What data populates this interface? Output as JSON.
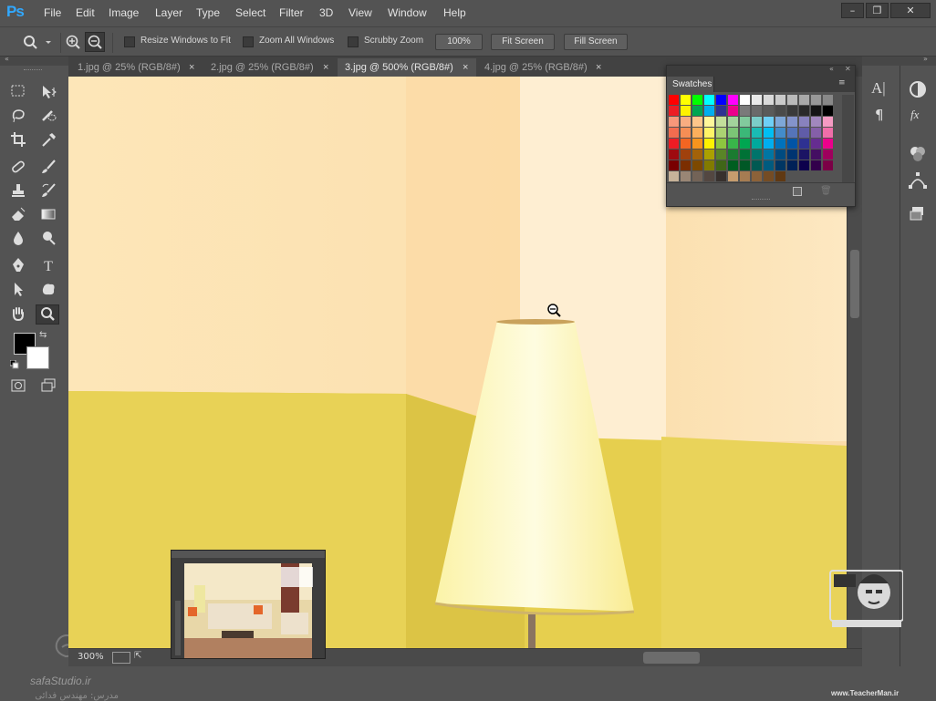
{
  "app": {
    "logo": "Ps"
  },
  "menu": [
    "File",
    "Edit",
    "Image",
    "Layer",
    "Type",
    "Select",
    "Filter",
    "3D",
    "View",
    "Window",
    "Help"
  ],
  "window_controls": {
    "minimize": "–",
    "restore": "❐",
    "close": "✕"
  },
  "options": {
    "resize_windows_label": "Resize Windows to Fit",
    "zoom_all_label": "Zoom All Windows",
    "scrubby_label": "Scrubby Zoom",
    "zoom_value": "100%",
    "fit_screen_label": "Fit Screen",
    "fill_screen_label": "Fill Screen"
  },
  "tabs": [
    {
      "label": "1.jpg @ 25% (RGB/8#)",
      "close": "×"
    },
    {
      "label": "2.jpg @ 25% (RGB/8#)",
      "close": "×"
    },
    {
      "label": "3.jpg @ 500% (RGB/8#)",
      "close": "×"
    },
    {
      "label": "4.jpg @ 25% (RGB/8#)",
      "close": "×"
    }
  ],
  "active_tab_index": 2,
  "swatches_panel": {
    "title": "Swatches"
  },
  "swatch_rows": [
    [
      "#ff0000",
      "#ffff00",
      "#00ff00",
      "#00ffff",
      "#0000ff",
      "#ff00ff",
      "#ffffff",
      "#e9e9e9",
      "#d9d9d9",
      "#cacaca",
      "#bababa",
      "#a9a9a9",
      "#989898",
      "#888888"
    ],
    [
      "#ed1c24",
      "#fff200",
      "#00a651",
      "#00aeef",
      "#2e3192",
      "#ec008c",
      "#7a7a7a",
      "#6a6a6a",
      "#5a5a5a",
      "#4a4a4a",
      "#3a3a3a",
      "#2a2a2a",
      "#151515",
      "#000000"
    ],
    [
      "#f7977a",
      "#f9ad81",
      "#fdc68a",
      "#fff79a",
      "#c4df9b",
      "#a3d39c",
      "#82ca9d",
      "#7bcdc8",
      "#6ecff6",
      "#7ea7d8",
      "#8493ca",
      "#8882be",
      "#a187be",
      "#f49ac2"
    ],
    [
      "#f26c4f",
      "#f68e55",
      "#fbaf5c",
      "#fff467",
      "#acd372",
      "#7cc576",
      "#3bb878",
      "#1abbb4",
      "#00bff3",
      "#438cca",
      "#5574b9",
      "#605ca8",
      "#855fa8",
      "#f06ea9"
    ],
    [
      "#ed1c24",
      "#f26522",
      "#f7941d",
      "#fff200",
      "#8dc63f",
      "#39b54a",
      "#00a651",
      "#00a99d",
      "#00aeef",
      "#0072bc",
      "#0054a6",
      "#2e3192",
      "#662d91",
      "#ec008c"
    ],
    [
      "#9e0b0f",
      "#a0410d",
      "#a36209",
      "#aba000",
      "#598527",
      "#1a7b30",
      "#007236",
      "#00746b",
      "#0076a3",
      "#004b80",
      "#003471",
      "#1b1464",
      "#440e62",
      "#9e005d"
    ],
    [
      "#790000",
      "#7b2e00",
      "#7d4900",
      "#827b00",
      "#406618",
      "#005e20",
      "#005826",
      "#005952",
      "#005b7f",
      "#003663",
      "#002157",
      "#0d004c",
      "#32004b",
      "#7b0046"
    ],
    [
      "#c7b299",
      "#998675",
      "#736357",
      "#534741",
      "#37302d",
      "#c69c6e",
      "#a67c52",
      "#8c6239",
      "#754c24",
      "#603913"
    ]
  ],
  "statusbar": {
    "zoom": "300%"
  },
  "watermarks": {
    "left_site": "safaStudio.ir",
    "left_sub": "مدرس: مهندس فدائی",
    "right_site": "www.TeacherMan.ir"
  }
}
